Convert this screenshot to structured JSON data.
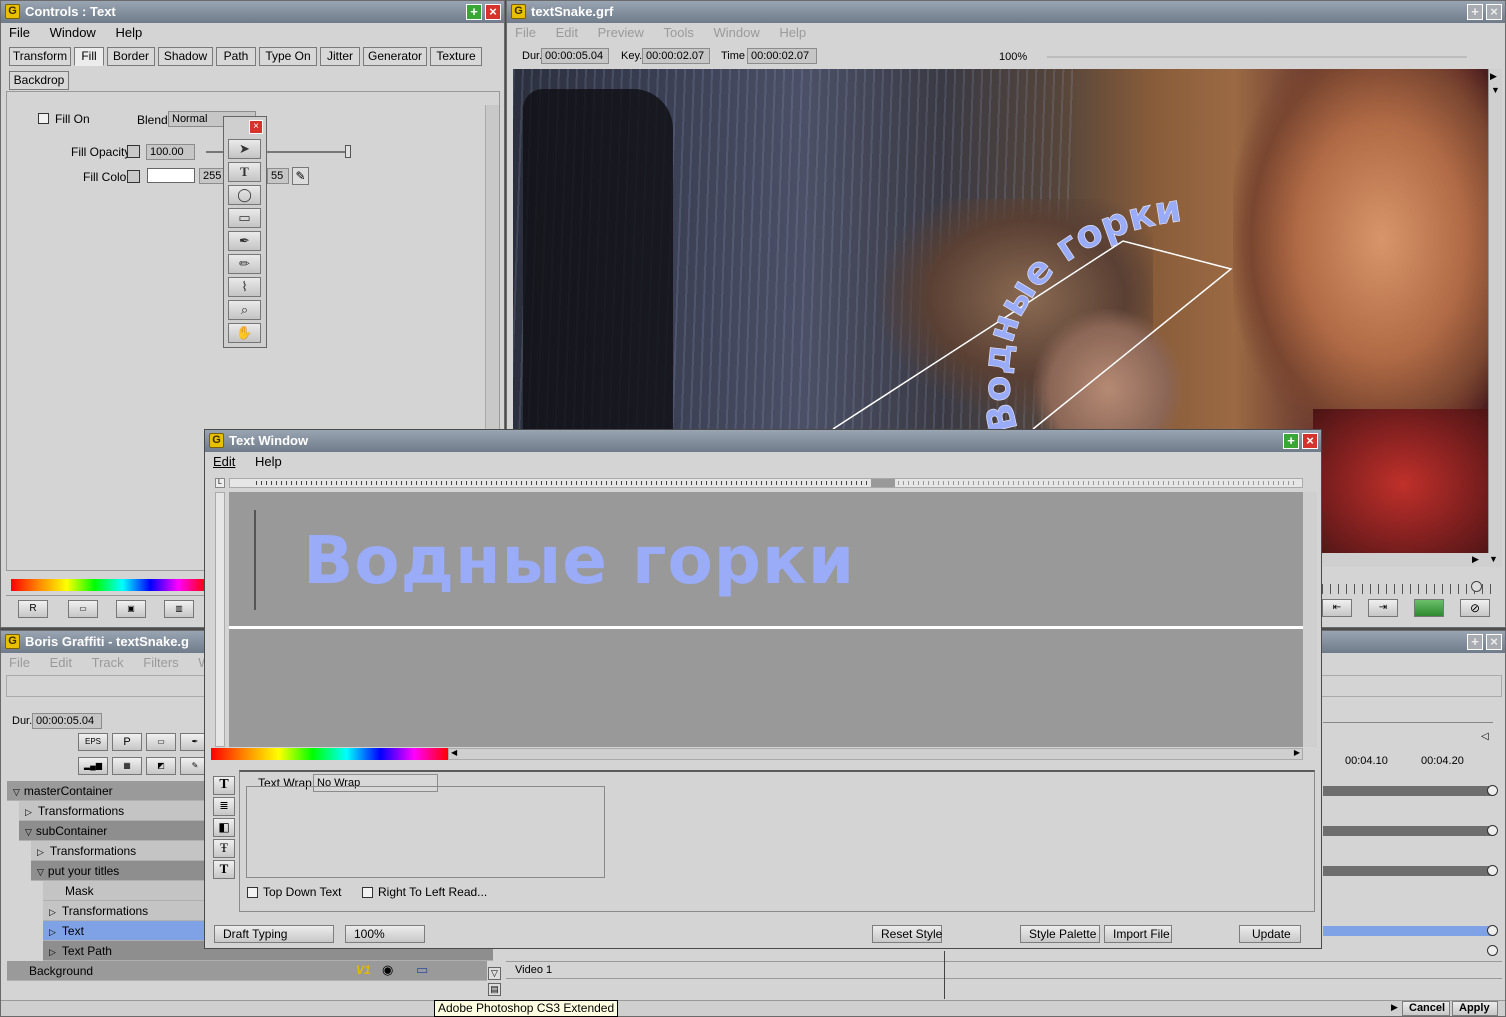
{
  "controls_window": {
    "title": "Controls : Text",
    "menu": [
      "File",
      "Window",
      "Help"
    ],
    "tabs": [
      "Transform",
      "Fill",
      "Border",
      "Shadow",
      "Path",
      "Type On",
      "Jitter",
      "Generator",
      "Texture"
    ],
    "tab2": "Backdrop",
    "fill_on_label": "Fill On",
    "blend_label": "Blend",
    "blend_value": "Normal",
    "opacity_label": "Fill Opacity",
    "opacity_value": "100.00",
    "fill_color_label": "Fill Color",
    "rgb_r": "255",
    "rgb_b": "55",
    "bottom_btn_r": "R"
  },
  "preview_window": {
    "title": "textSnake.grf",
    "menu": [
      "File",
      "Edit",
      "Preview",
      "Tools",
      "Window",
      "Help"
    ],
    "dur_label": "Dur.",
    "dur_value": "00:00:05.04",
    "key_label": "Key.",
    "key_value": "00:00:02.07",
    "time_label": "Time",
    "time_value": "00:00:02.07",
    "zoom": "100%",
    "overlay_text": "Водные горки"
  },
  "text_window": {
    "title": "Text Window",
    "menu": [
      "Edit",
      "Help"
    ],
    "main_text": "Водные горки",
    "text_color": "#9aabf7",
    "text_wrap_label": "Text Wrap",
    "text_wrap_value": "No Wrap",
    "top_down_label": "Top Down Text",
    "right_to_left_label": "Right To Left Read...",
    "draft_typing": "Draft Typing",
    "zoom": "100%",
    "reset_style": "Reset Style",
    "style_palette": "Style Palette",
    "import_file": "Import File",
    "update": "Update"
  },
  "timeline_window": {
    "title": "Boris Graffiti - textSnake.g",
    "menu": [
      "File",
      "Edit",
      "Track",
      "Filters",
      "Windo"
    ],
    "dur_label": "Dur.",
    "dur_value": "00:00:05.04",
    "btn_eps": "EPS",
    "btn_p": "P",
    "tree": [
      "masterContainer",
      "Transformations",
      "subContainer",
      "Transformations",
      "put your titles",
      "Mask",
      "Transformations",
      "Text",
      "Text Path",
      "Background"
    ],
    "v1": "V1",
    "track_label": "Video 1",
    "times": [
      "00:04.10",
      "00:04.20"
    ],
    "cancel": "Cancel",
    "apply": "Apply",
    "tooltip": "Adobe Photoshop CS3 Extended"
  },
  "colors": {
    "accent_blue": "#7fa2e6",
    "title_gradient_top": "#9aa5b3",
    "close_red": "#d5332c",
    "max_green": "#3aa635"
  }
}
